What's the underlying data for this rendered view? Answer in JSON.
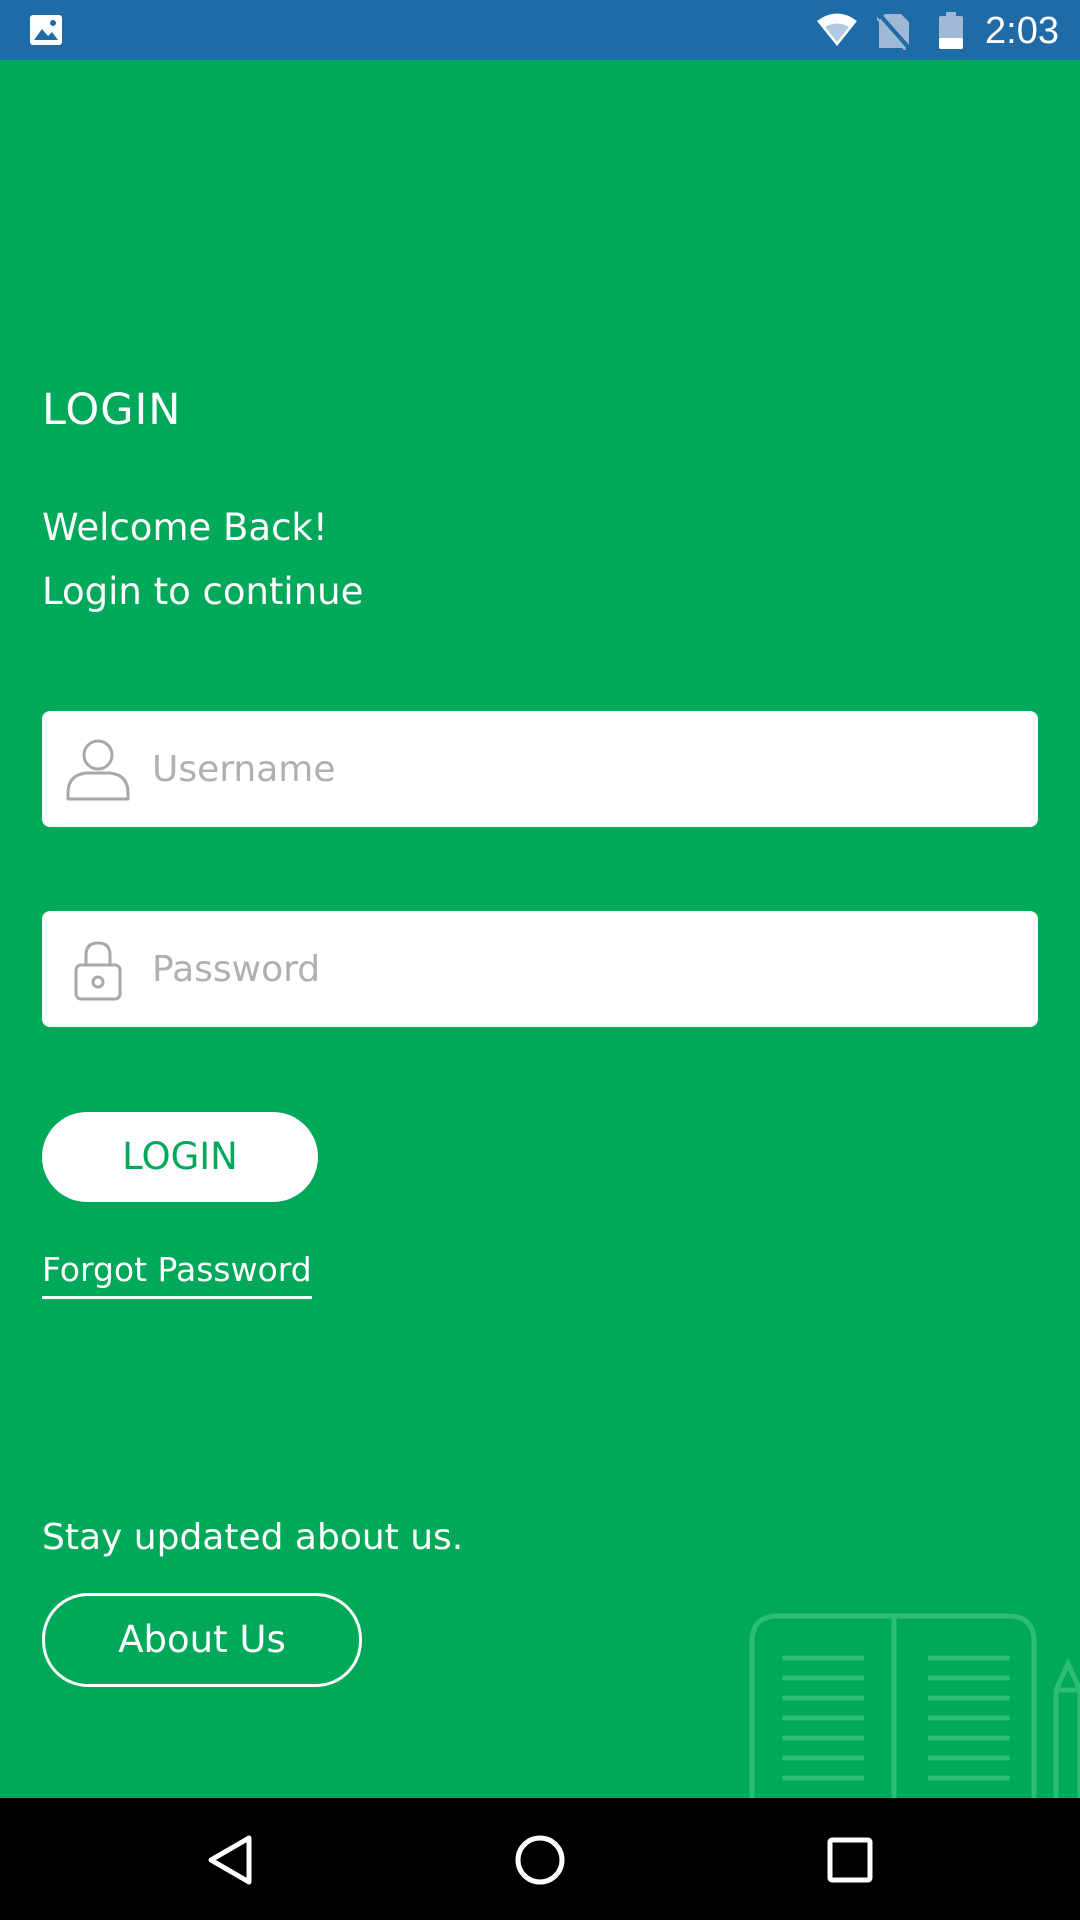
{
  "status_bar": {
    "time": "2:03",
    "background_color": "#1E6BA8",
    "icons": [
      "gallery-icon",
      "wifi-icon",
      "no-sim-icon",
      "battery-icon"
    ]
  },
  "login": {
    "title": "LOGIN",
    "welcome": "Welcome Back!",
    "subtitle": "Login to continue",
    "username": {
      "placeholder": "Username",
      "value": "",
      "icon": "user-icon"
    },
    "password": {
      "placeholder": "Password",
      "value": "",
      "icon": "lock-icon"
    },
    "login_button_label": "LOGIN",
    "forgot_password_label": "Forgot Password"
  },
  "footer": {
    "stay_updated_text": "Stay updated about us.",
    "about_button_label": "About Us",
    "decoration_icon": "book-icon"
  },
  "navigation": {
    "icons": [
      "back-icon",
      "home-icon",
      "recents-icon"
    ]
  },
  "colors": {
    "background": "#00A859",
    "accent_text": "#00A859",
    "placeholder": "#B0B0B0",
    "nav_bar": "#000000"
  }
}
